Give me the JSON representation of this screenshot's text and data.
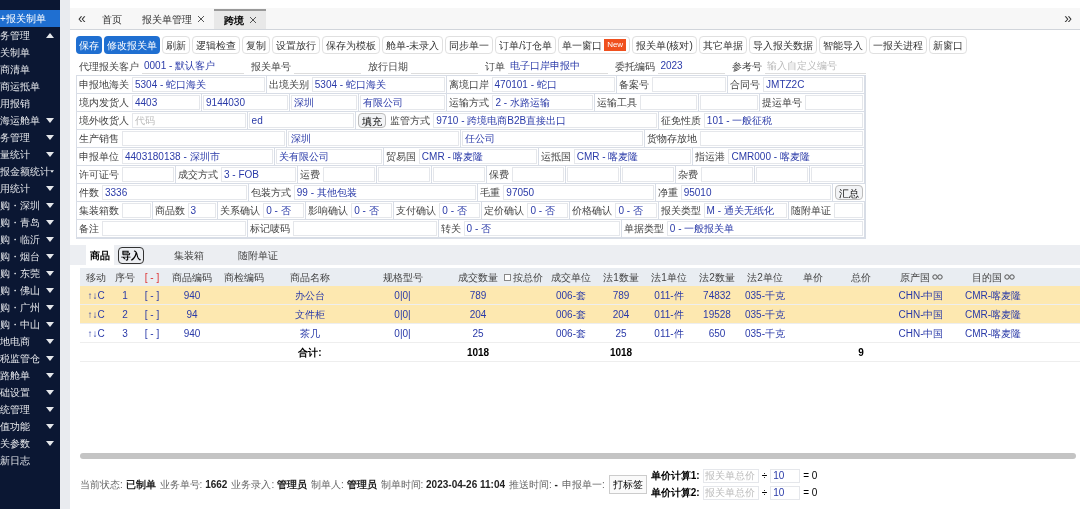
{
  "sidebar": {
    "items": [
      {
        "label": "+报关制单",
        "selected": true,
        "kind": "item"
      },
      {
        "label": "务管理",
        "selected": false,
        "kind": "group",
        "expanded": true
      },
      {
        "label": "关制单",
        "selected": false,
        "kind": "item"
      },
      {
        "label": "商清单",
        "selected": false,
        "kind": "item"
      },
      {
        "label": "商运抵单",
        "selected": false,
        "kind": "item"
      },
      {
        "label": "用报销",
        "selected": false,
        "kind": "item"
      },
      {
        "label": "海运舱单",
        "selected": false,
        "kind": "group",
        "expanded": false
      },
      {
        "label": "务管理",
        "selected": false,
        "kind": "group",
        "expanded": false
      },
      {
        "label": "量统计",
        "selected": false,
        "kind": "group",
        "expanded": false
      },
      {
        "label": "报金额统计",
        "selected": false,
        "kind": "group",
        "expanded": false
      },
      {
        "label": "用统计",
        "selected": false,
        "kind": "group",
        "expanded": false
      },
      {
        "label": "购・深圳",
        "selected": false,
        "kind": "group",
        "expanded": false
      },
      {
        "label": "购・青岛",
        "selected": false,
        "kind": "group",
        "expanded": false
      },
      {
        "label": "购・临沂",
        "selected": false,
        "kind": "group",
        "expanded": false
      },
      {
        "label": "购・烟台",
        "selected": false,
        "kind": "group",
        "expanded": false
      },
      {
        "label": "购・东莞",
        "selected": false,
        "kind": "group",
        "expanded": false
      },
      {
        "label": "购・佛山",
        "selected": false,
        "kind": "group",
        "expanded": false
      },
      {
        "label": "购・广州",
        "selected": false,
        "kind": "group",
        "expanded": false
      },
      {
        "label": "购・中山",
        "selected": false,
        "kind": "group",
        "expanded": false
      },
      {
        "label": "地电商",
        "selected": false,
        "kind": "group",
        "expanded": false
      },
      {
        "label": "税监管仓",
        "selected": false,
        "kind": "group",
        "expanded": false
      },
      {
        "label": "路舱单",
        "selected": false,
        "kind": "group",
        "expanded": false
      },
      {
        "label": "础设置",
        "selected": false,
        "kind": "group",
        "expanded": false
      },
      {
        "label": "统管理",
        "selected": false,
        "kind": "group",
        "expanded": false
      },
      {
        "label": "值功能",
        "selected": false,
        "kind": "group",
        "expanded": false
      },
      {
        "label": "关参数",
        "selected": false,
        "kind": "group",
        "expanded": false
      },
      {
        "label": "新日志",
        "selected": false,
        "kind": "item"
      }
    ]
  },
  "nav": {
    "collapse": "«",
    "expand": "»"
  },
  "tabs": [
    {
      "label": "首页",
      "selected": false,
      "closable": false
    },
    {
      "label": "报关单管理",
      "selected": false,
      "closable": true
    },
    {
      "label": "跨境",
      "selected": true,
      "closable": true
    }
  ],
  "toolbar": [
    {
      "label": "保存",
      "kind": "primary"
    },
    {
      "label": "修改报关单",
      "kind": "primary"
    },
    {
      "label": "刷新",
      "kind": "plain"
    },
    {
      "label": "逻辑检查",
      "kind": "plain"
    },
    {
      "label": "复制",
      "kind": "plain"
    },
    {
      "label": "设置放行",
      "kind": "plain"
    },
    {
      "label": "保存为模板",
      "kind": "plain"
    },
    {
      "label": "舱单-未录入",
      "kind": "plain"
    },
    {
      "label": "同步单一",
      "kind": "plain"
    },
    {
      "label": "订单/订仓单",
      "kind": "plain"
    },
    {
      "label": "单一窗口",
      "kind": "plain",
      "badge": "New"
    },
    {
      "label": "报关单(核对)",
      "kind": "plain"
    },
    {
      "label": "其它单据",
      "kind": "plain"
    },
    {
      "label": "导入报关数据",
      "kind": "plain"
    },
    {
      "label": "智能导入",
      "kind": "plain"
    },
    {
      "label": "一报关进程",
      "kind": "plain"
    },
    {
      "label": "新窗口",
      "kind": "plain"
    }
  ],
  "header_fields": [
    {
      "label": "代理报关客户",
      "value": "0001 - 默认客户"
    },
    {
      "label": "报关单号"
    },
    {
      "label": "放行日期"
    },
    {
      "label": "订单",
      "value": "电子口岸申报中"
    },
    {
      "label": "委托编码",
      "value": "2023"
    },
    {
      "label": "参考号",
      "placeholder": "输入自定义编号"
    }
  ],
  "form_rows": [
    [
      {
        "kind": "field",
        "label": "申报地海关",
        "value": "5304 - 蛇口海关"
      },
      {
        "kind": "field",
        "label": "出境关别",
        "value": "5304 - 蛇口海关"
      },
      {
        "kind": "field",
        "label": "离境口岸",
        "value": "470101 - 蛇口"
      },
      {
        "kind": "field",
        "label": "备案号"
      },
      {
        "kind": "field",
        "label": "合同号",
        "value": "JMTZ2C"
      }
    ],
    [
      {
        "kind": "field",
        "label": "境内发货人",
        "value": "4403"
      },
      {
        "kind": "field",
        "value": "9144030"
      },
      {
        "kind": "field",
        "value": "深圳"
      },
      {
        "kind": "field",
        "value": "有限公司"
      },
      {
        "kind": "field",
        "label": "运输方式",
        "value": "2 - 水路运输"
      },
      {
        "kind": "field",
        "label": "运输工具"
      },
      {
        "kind": "field"
      },
      {
        "kind": "field",
        "label": "提运单号"
      }
    ],
    [
      {
        "kind": "field",
        "label": "境外收货人",
        "placeholder": "代码"
      },
      {
        "kind": "field",
        "value": "ed"
      },
      {
        "kind": "button",
        "label": "填充"
      },
      {
        "kind": "field",
        "label": "监管方式",
        "value": "9710 - 跨境电商B2B直接出口"
      },
      {
        "kind": "field",
        "label": "征免性质",
        "value": "101 - 一般征税"
      }
    ],
    [
      {
        "kind": "field",
        "label": "生产销售"
      },
      {
        "kind": "field",
        "value": "深圳"
      },
      {
        "kind": "field",
        "value": "任公司"
      },
      {
        "kind": "field",
        "label": "货物存放地"
      }
    ],
    [
      {
        "kind": "field",
        "label": "申报单位",
        "value": "4403180138 - 深圳市"
      },
      {
        "kind": "field",
        "value": "关有限公司"
      },
      {
        "kind": "field",
        "label": "贸易国",
        "value": "CMR - 喀麦隆"
      },
      {
        "kind": "field",
        "label": "运抵国",
        "value": "CMR - 喀麦隆"
      },
      {
        "kind": "field",
        "label": "指运港",
        "value": "CMR000 - 喀麦隆"
      }
    ],
    [
      {
        "kind": "field",
        "label": "许可证号"
      },
      {
        "kind": "field",
        "label": "成交方式",
        "value": "3 - FOB"
      },
      {
        "kind": "field",
        "label": "运费"
      },
      {
        "kind": "field"
      },
      {
        "kind": "field"
      },
      {
        "kind": "field",
        "label": "保费"
      },
      {
        "kind": "field"
      },
      {
        "kind": "field"
      },
      {
        "kind": "field",
        "label": "杂费"
      },
      {
        "kind": "field"
      },
      {
        "kind": "field"
      }
    ],
    [
      {
        "kind": "field",
        "label": "件数",
        "value": "3336"
      },
      {
        "kind": "field",
        "label": "包装方式",
        "value": "99 - 其他包装"
      },
      {
        "kind": "field",
        "label": "毛重",
        "value": "97050"
      },
      {
        "kind": "field",
        "label": "净重",
        "value": "95010"
      },
      {
        "kind": "button",
        "label": "汇总"
      }
    ],
    [
      {
        "kind": "field",
        "label": "集装箱数"
      },
      {
        "kind": "field",
        "label": "商品数",
        "value": "3"
      },
      {
        "kind": "field",
        "label": "关系确认",
        "value": "0 - 否"
      },
      {
        "kind": "field",
        "label": "影响确认",
        "value": "0 - 否"
      },
      {
        "kind": "field",
        "label": "支付确认",
        "value": "0 - 否"
      },
      {
        "kind": "field",
        "label": "定价确认",
        "value": "0 - 否"
      },
      {
        "kind": "field",
        "label": "价格确认",
        "value": "0 - 否"
      },
      {
        "kind": "field",
        "label": "报关类型",
        "value": "M - 通关无纸化"
      },
      {
        "kind": "field",
        "label": "随附单证"
      }
    ],
    [
      {
        "kind": "field",
        "label": "备注"
      },
      {
        "kind": "field",
        "label": "标记唛码"
      },
      {
        "kind": "field",
        "label": "转关",
        "value": "0 - 否"
      },
      {
        "kind": "field",
        "label": "单据类型",
        "value": "0 - 一般报关单"
      }
    ]
  ],
  "sub_tabs": [
    {
      "label": "商品",
      "selected": true,
      "action": "导入"
    },
    {
      "label": "集装箱",
      "selected": false
    },
    {
      "label": "随附单证",
      "selected": false
    }
  ],
  "table": {
    "columns": [
      "移动",
      "序号",
      "[ - ]",
      "商品编码",
      "商检编码",
      "商品名称",
      "规格型号",
      "成交数量",
      "按总价",
      "成交单位",
      "法1数量",
      "法1单位",
      "法2数量",
      "法2单位",
      "单价",
      "总价",
      "原产国",
      "目的国"
    ],
    "total_price_checkbox": {
      "checked": false
    },
    "rows": [
      {
        "selected": true,
        "cells": [
          "↑↓C",
          "1",
          "[ - ]",
          "940",
          null,
          "办公台",
          "0|0|",
          "789",
          null,
          "006-套",
          "789",
          "011-件",
          "74832",
          "035-千克",
          null,
          null,
          "CHN-中国",
          "CMR-喀麦隆"
        ]
      },
      {
        "selected": true,
        "cells": [
          "↑↓C",
          "2",
          "[ - ]",
          "94",
          null,
          "文件柜",
          "0|0|",
          "204",
          null,
          "006-套",
          "204",
          "011-件",
          "19528",
          "035-千克",
          null,
          null,
          "CHN-中国",
          "CMR-喀麦隆"
        ]
      },
      {
        "selected": false,
        "cells": [
          "↑↓C",
          "3",
          "[ - ]",
          "940",
          null,
          "茶几",
          "0|0|",
          "25",
          null,
          "006-套",
          "25",
          "011-件",
          "650",
          "035-千克",
          null,
          null,
          "CHN-中国",
          "CMR-喀麦隆"
        ]
      }
    ],
    "totals": {
      "label": "合计:",
      "cells": [
        null,
        null,
        null,
        null,
        null,
        null,
        null,
        "1018",
        null,
        null,
        "1018",
        null,
        null,
        null,
        null,
        "9",
        null,
        null
      ]
    }
  },
  "status_bar": [
    {
      "label": "当前状态:",
      "value": "已制单"
    },
    {
      "label": "业务单号:",
      "value": "1662"
    },
    {
      "label": "业务录入:",
      "value": "管理员"
    },
    {
      "label": "制单人:",
      "value": "管理员"
    },
    {
      "label": "制单时间:",
      "value": "2023-04-26 11:04"
    },
    {
      "label": "推送时间:",
      "value": "-"
    },
    {
      "label": "申报单一:"
    }
  ],
  "status_button": "打标签",
  "price_calcs": [
    {
      "label": "单价计算1:",
      "placeholder": "报关单总价",
      "operator": "÷",
      "divisor": "10",
      "result": "= 0"
    },
    {
      "label": "单价计算2:",
      "placeholder": "报关单总价",
      "operator": "÷",
      "divisor": "10",
      "result": "= 0"
    }
  ]
}
